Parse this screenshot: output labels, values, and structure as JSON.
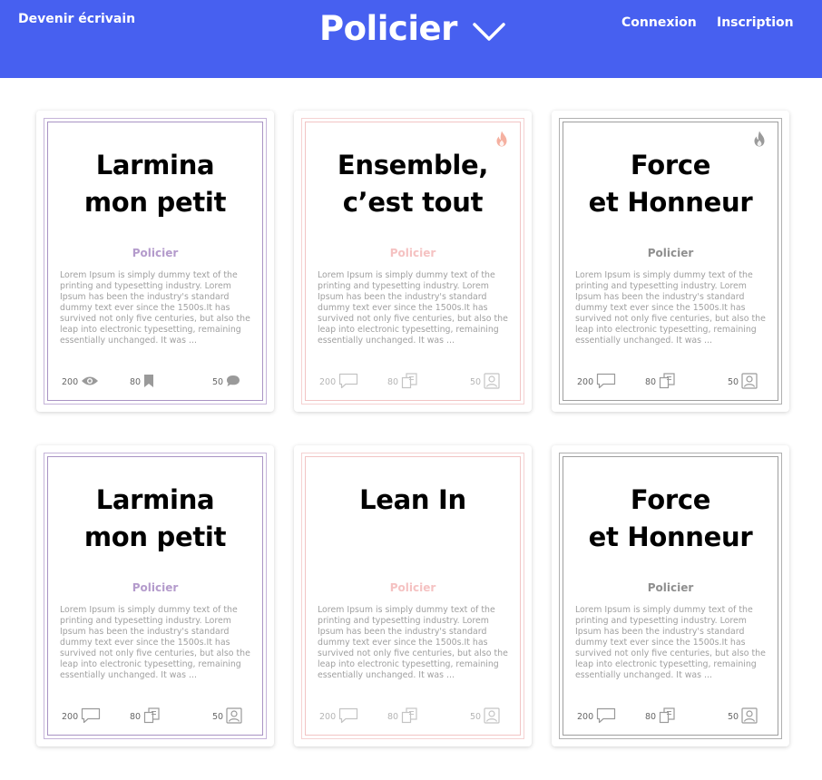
{
  "header": {
    "become_writer": "Devenir écrivain",
    "title": "Policier",
    "login": "Connexion",
    "signup": "Inscription"
  },
  "colors": {
    "header_bg": "#4760f0",
    "purple": "#b49bcc",
    "pink": "#f5c2c2",
    "gray": "#9a9a9a"
  },
  "cards": [
    {
      "title": "Larmina\nmon petit",
      "category": "Policier",
      "text": "Lorem Ipsum is simply dummy text of the printing and typesetting industry. Lorem Ipsum has been the industry's standard dummy text ever since the 1500s.It has survived not only five centuries, but also the leap into electronic typesetting, remaining essentially unchanged. It was ...",
      "theme": "purple",
      "flame": false,
      "stat1": "200",
      "stat1_icon": "eye-icon",
      "stat2": "80",
      "stat2_icon": "bookmark-icon",
      "stat3": "50",
      "stat3_icon": "comment-icon"
    },
    {
      "title": "Ensemble,\nc’est tout",
      "category": "Policier",
      "text": "Lorem Ipsum is simply dummy text of the printing and typesetting industry. Lorem Ipsum has been the industry's standard dummy text ever since the 1500s.It has survived not only five centuries, but also the leap into electronic typesetting, remaining essentially unchanged. It was ...",
      "theme": "pink",
      "flame": true,
      "stat1": "200",
      "stat1_icon": "comment-outline-icon",
      "stat2": "80",
      "stat2_icon": "pages-icon",
      "stat3": "50",
      "stat3_icon": "user-icon"
    },
    {
      "title": "Force\net Honneur",
      "category": "Policier",
      "text": "Lorem Ipsum is simply dummy text of the printing and typesetting industry. Lorem Ipsum has been the industry's standard dummy text ever since the 1500s.It has survived not only five centuries, but also the leap into electronic typesetting, remaining essentially unchanged. It was ...",
      "theme": "gray",
      "flame": true,
      "stat1": "200",
      "stat1_icon": "comment-outline-icon",
      "stat2": "80",
      "stat2_icon": "pages-icon",
      "stat3": "50",
      "stat3_icon": "user-icon"
    },
    {
      "title": "Larmina\nmon petit",
      "category": "Policier",
      "text": "Lorem Ipsum is simply dummy text of the printing and typesetting industry. Lorem Ipsum has been the industry's standard dummy text ever since the 1500s.It has survived not only five centuries, but also the leap into electronic typesetting, remaining essentially unchanged. It was ...",
      "theme": "purple",
      "flame": false,
      "stat1": "200",
      "stat1_icon": "comment-outline-icon",
      "stat2": "80",
      "stat2_icon": "pages-icon",
      "stat3": "50",
      "stat3_icon": "user-icon"
    },
    {
      "title": "Lean In",
      "category": "Policier",
      "text": "Lorem Ipsum is simply dummy text of the printing and typesetting industry. Lorem Ipsum has been the industry's standard dummy text ever since the 1500s.It has survived not only five centuries, but also the leap into electronic typesetting, remaining essentially unchanged. It was ...",
      "theme": "pink",
      "flame": false,
      "stat1": "200",
      "stat1_icon": "comment-outline-icon",
      "stat2": "80",
      "stat2_icon": "pages-icon",
      "stat3": "50",
      "stat3_icon": "user-icon"
    },
    {
      "title": "Force\net Honneur",
      "category": "Policier",
      "text": "Lorem Ipsum is simply dummy text of the printing and typesetting industry. Lorem Ipsum has been the industry's standard dummy text ever since the 1500s.It has survived not only five centuries, but also the leap into electronic typesetting, remaining essentially unchanged. It was ...",
      "theme": "gray",
      "flame": false,
      "stat1": "200",
      "stat1_icon": "comment-outline-icon",
      "stat2": "80",
      "stat2_icon": "pages-icon",
      "stat3": "50",
      "stat3_icon": "user-icon"
    }
  ]
}
